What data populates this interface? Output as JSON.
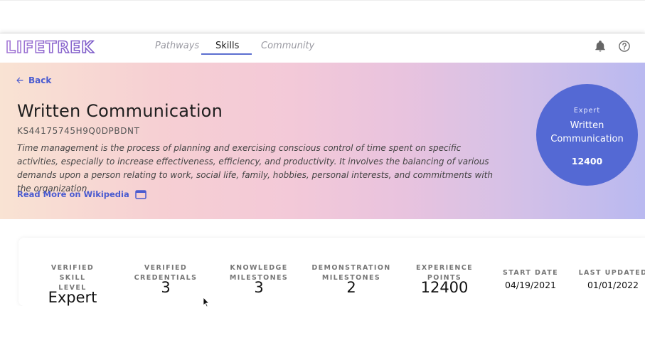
{
  "brand": {
    "logo_text": "LIFETREK"
  },
  "nav": {
    "tabs": [
      {
        "label": "Pathways"
      },
      {
        "label": "Skills"
      },
      {
        "label": "Community"
      }
    ]
  },
  "hero": {
    "back_label": "Back",
    "title": "Written Communication",
    "code": "KS44175745H9Q0DPBDNT",
    "description": "Time management is the process of planning and exercising conscious control of time spent on specific activities, especially to increase effectiveness, efficiency, and productivity. It involves the balancing of various demands upon a person relating to work, social life, family, hobbies, personal interests, and commitments with the organization",
    "read_more": "Read More on Wikipedia"
  },
  "badge": {
    "level": "Expert",
    "name_line1": "Written",
    "name_line2": "Communication",
    "points": "12400"
  },
  "stats": [
    {
      "label1": "VERIFIED SKILL",
      "label2": "LEVEL",
      "value": "Expert"
    },
    {
      "label1": "VERIFIED",
      "label2": "CREDENTIALS",
      "value": "3"
    },
    {
      "label1": "KNOWLEDGE",
      "label2": "MILESTONES",
      "value": "3"
    },
    {
      "label1": "DEMONSTRATION",
      "label2": "MILESTONES",
      "value": "2"
    },
    {
      "label1": "EXPERIENCE",
      "label2": "POINTS",
      "value": "12400"
    },
    {
      "label1": "START DATE",
      "value": "04/19/2021"
    },
    {
      "label1": "LAST UPDATED",
      "value": "01/01/2022"
    }
  ],
  "colors": {
    "accent": "#5469d4",
    "link": "#4a5bd0"
  },
  "icons": {
    "back": "arrow-left-icon",
    "external": "external-window-icon",
    "notifications": "bell-icon",
    "help": "help-circle-icon"
  }
}
